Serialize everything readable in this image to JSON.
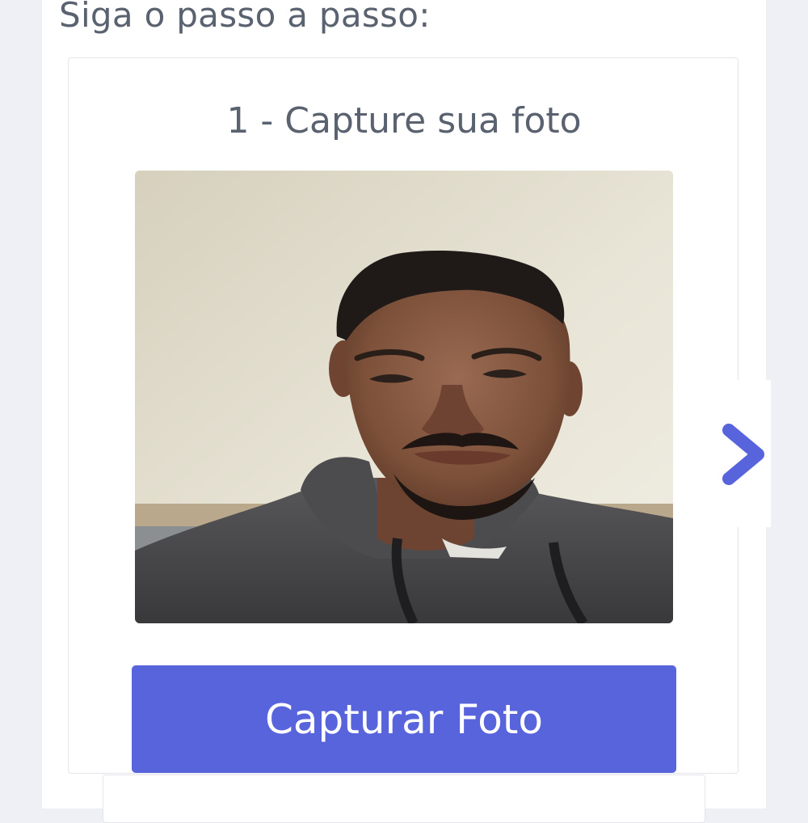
{
  "steps": {
    "heading": "Siga o passo a passo:",
    "current": {
      "title": "1 - Capture sua foto",
      "button_label": "Capturar Foto"
    }
  },
  "photo": {
    "subject": "selfie-preview",
    "colors": {
      "wall": "#e6e2d3",
      "skin": "#8a5a43",
      "hair": "#1f1a18",
      "hoodie": "#4a4a4c"
    }
  },
  "navigation": {
    "next_icon": "chevron-right-icon"
  },
  "theme": {
    "accent": "#5864dc",
    "heading_color": "#5a6270"
  }
}
